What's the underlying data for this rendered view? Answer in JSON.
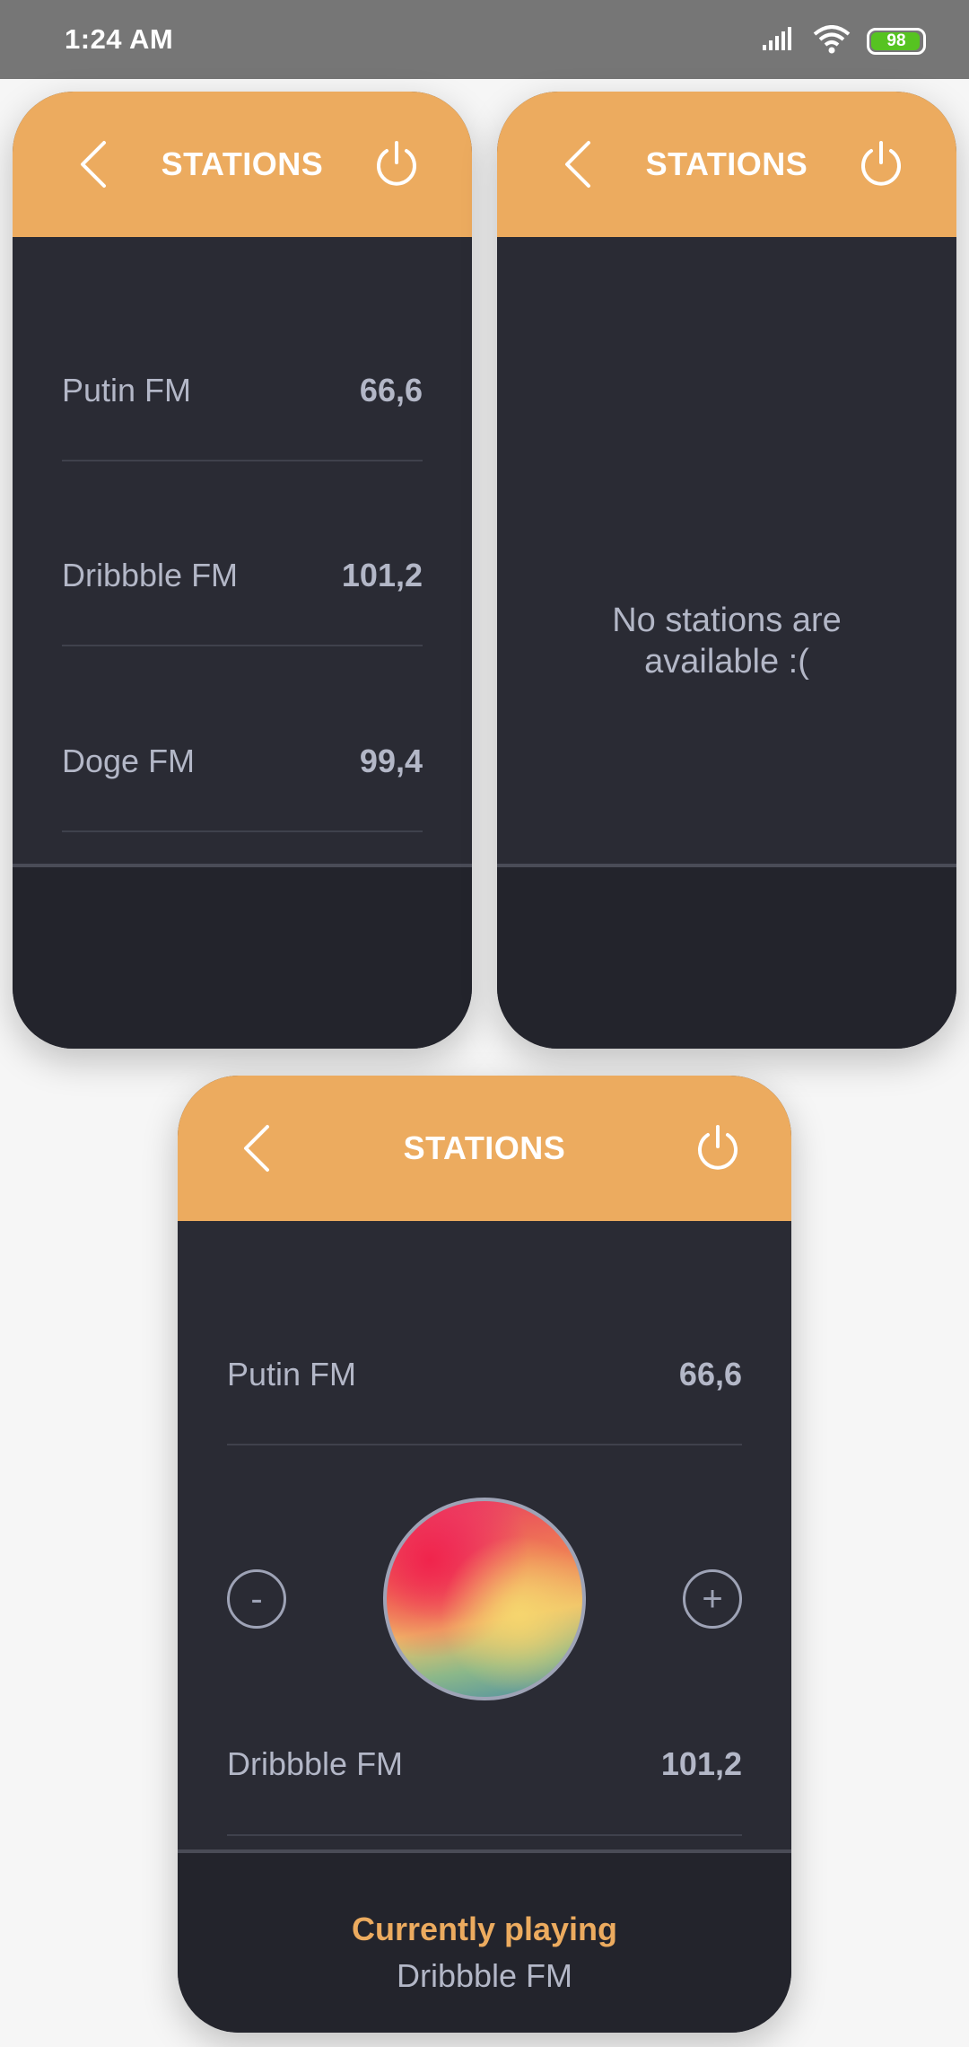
{
  "status_bar": {
    "time": "1:24 AM",
    "battery": "98"
  },
  "colors": {
    "accent": "#ecab5f",
    "card_bg": "#2a2b34",
    "text": "#b3b7c7"
  },
  "card1": {
    "title": "STATIONS",
    "stations": [
      {
        "name": "Putin FM",
        "freq": "66,6"
      },
      {
        "name": "Dribbble FM",
        "freq": "101,2"
      },
      {
        "name": "Doge FM",
        "freq": "99,4"
      }
    ]
  },
  "card2": {
    "title": "STATIONS",
    "empty_message_line1": "No stations are",
    "empty_message_line2": "available :("
  },
  "card3": {
    "title": "STATIONS",
    "stations": [
      {
        "name": "Putin FM",
        "freq": "66,6"
      },
      {
        "name": "Dribbble FM",
        "freq": "101,2"
      }
    ],
    "minus_label": "-",
    "plus_label": "+",
    "currently_playing_label": "Currently playing",
    "currently_playing_station": "Dribbble FM"
  }
}
